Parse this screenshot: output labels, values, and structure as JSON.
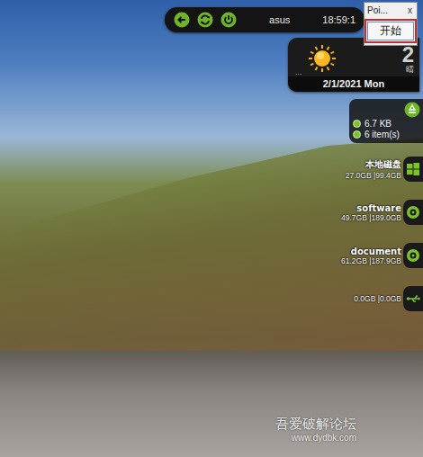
{
  "topbar": {
    "user": "asus",
    "time": "18:59:1"
  },
  "popup": {
    "title": "Poi...",
    "close": "x",
    "button": {
      "label": "开始",
      "focused": true
    }
  },
  "weather": {
    "temp": "2",
    "condition": "晴",
    "date": "2/1/2021 Mon",
    "more": "..."
  },
  "recycle": {
    "size": "6.7 KB",
    "items": "6 item(s)"
  },
  "drives": [
    {
      "name": "本地磁盘",
      "usage": "27.0GB |99.4GB",
      "kind": "system"
    },
    {
      "name": "software",
      "usage": "49.7GB |189.0GB",
      "kind": "disk"
    },
    {
      "name": "document",
      "usage": "61.2GB |187.9GB",
      "kind": "disk"
    },
    {
      "name": "",
      "usage": "0.0GB |0.0GB",
      "kind": "usb"
    }
  ],
  "watermark": {
    "title": "吾爱破解论坛",
    "url": "www.dydbk.com"
  }
}
